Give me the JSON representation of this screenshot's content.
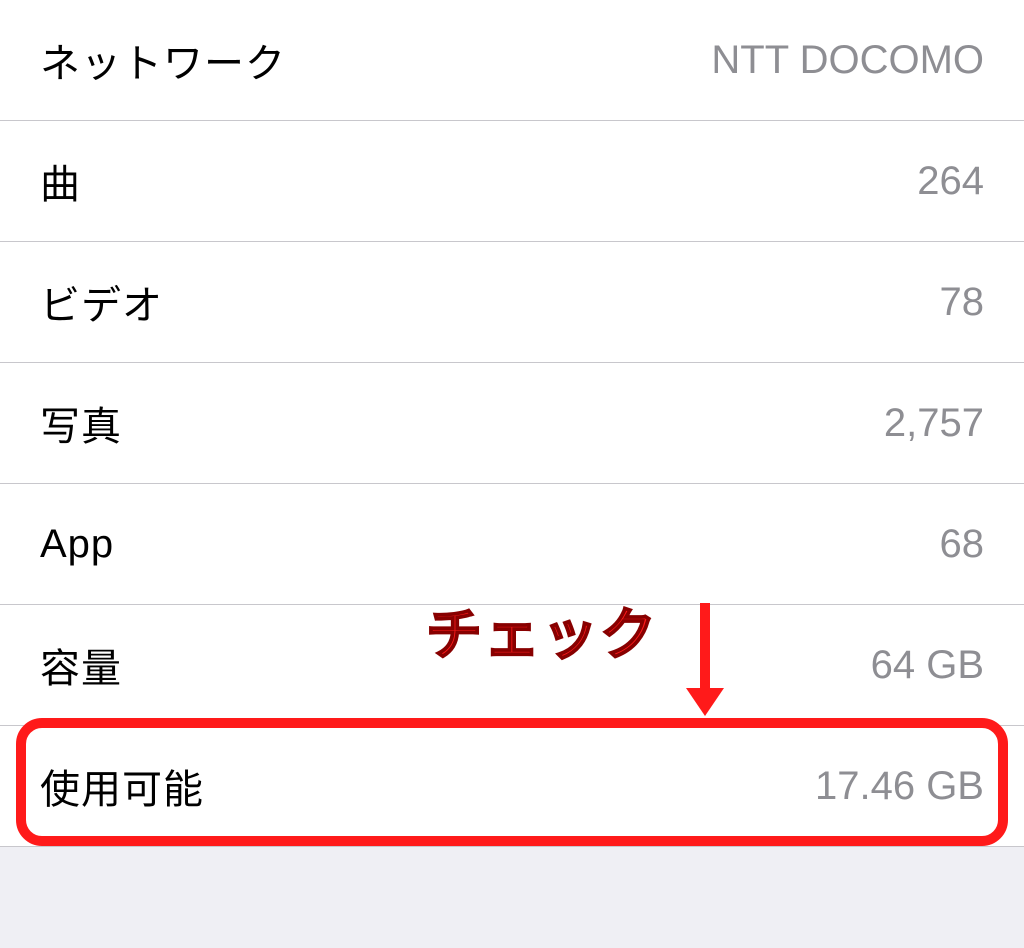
{
  "annotation": {
    "text": "チェック",
    "arrow": "↓"
  },
  "rows": [
    {
      "label": "ネットワーク",
      "value": "NTT DOCOMO"
    },
    {
      "label": "曲",
      "value": "264"
    },
    {
      "label": "ビデオ",
      "value": "78"
    },
    {
      "label": "写真",
      "value": "2,757"
    },
    {
      "label": "App",
      "value": "68"
    },
    {
      "label": "容量",
      "value": "64 GB"
    },
    {
      "label": "使用可能",
      "value": "17.46 GB"
    }
  ]
}
